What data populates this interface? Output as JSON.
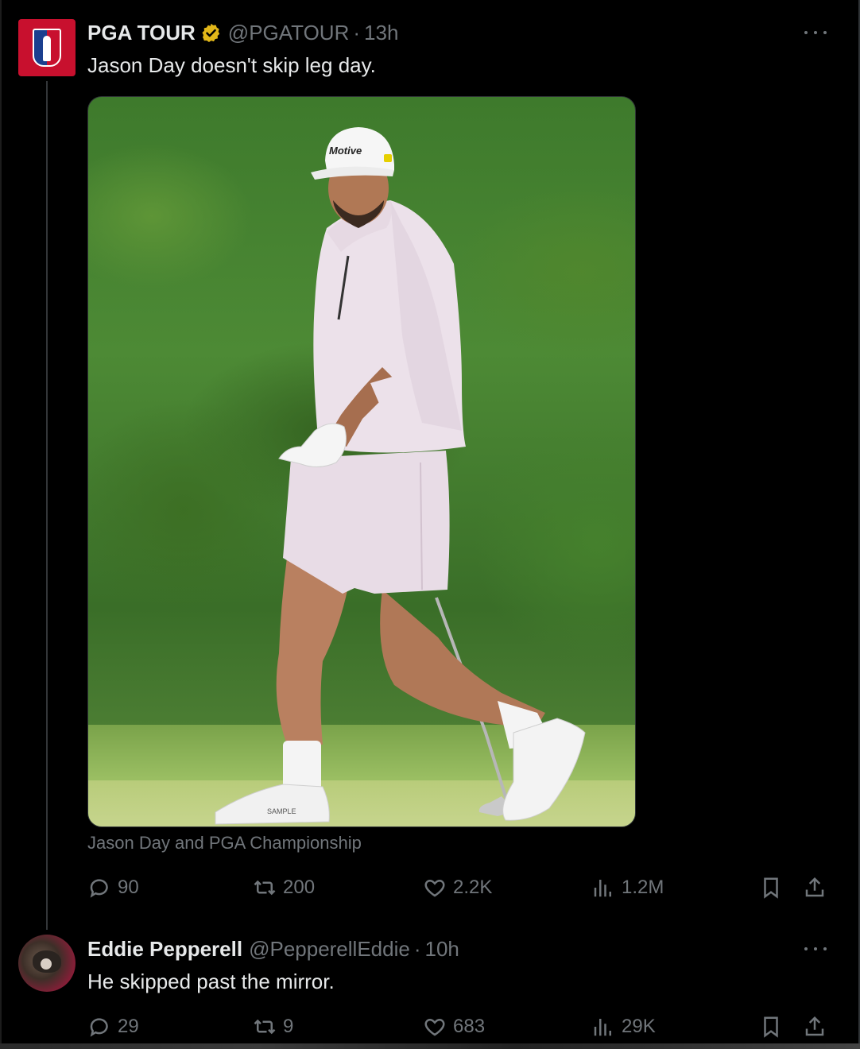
{
  "main_tweet": {
    "author_name": "PGA TOUR",
    "handle": "@PGATOUR",
    "separator": "·",
    "time": "13h",
    "text": "Jason Day doesn't skip leg day.",
    "media_tags": "Jason Day and PGA Championship",
    "cap_brand": "Motive",
    "shoe_text": "SAMPLE",
    "stats": {
      "replies": "90",
      "reposts": "200",
      "likes": "2.2K",
      "views": "1.2M"
    }
  },
  "reply_tweet": {
    "author_name": "Eddie Pepperell",
    "handle": "@PepperellEddie",
    "separator": "·",
    "time": "10h",
    "text": "He skipped past the mirror.",
    "stats": {
      "replies": "29",
      "reposts": "9",
      "likes": "683",
      "views": "29K"
    }
  },
  "colors": {
    "background": "#000000",
    "text_primary": "#e7e9ea",
    "text_secondary": "#71767b",
    "verified_gold": "#e2b719",
    "brand_red": "#c8102e",
    "brand_blue": "#1b3f8f"
  },
  "icons": [
    "reply-icon",
    "repost-icon",
    "like-icon",
    "views-icon",
    "bookmark-icon",
    "share-icon",
    "more-icon",
    "verified-badge-icon"
  ]
}
